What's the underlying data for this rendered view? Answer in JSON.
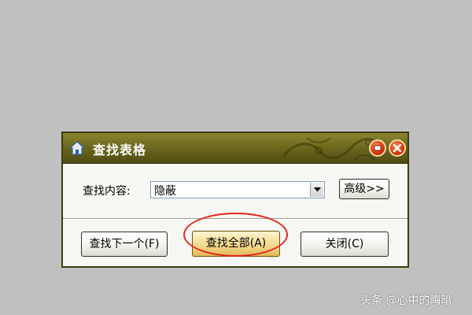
{
  "dialog": {
    "title": "查找表格",
    "title_icon": "house-icon",
    "search_label": "查找内容:",
    "search_value": "隐蔽",
    "advanced_label": "高级>>",
    "find_next_label": "查找下一个(F)",
    "find_all_label": "查找全部(A)",
    "close_label": "关闭(C)"
  },
  "watermark": "头条 @心中的晦暗",
  "colors": {
    "titlebar": "#6d6a1f",
    "highlight_ring": "#e0261d",
    "close_button": "#d3350f"
  }
}
